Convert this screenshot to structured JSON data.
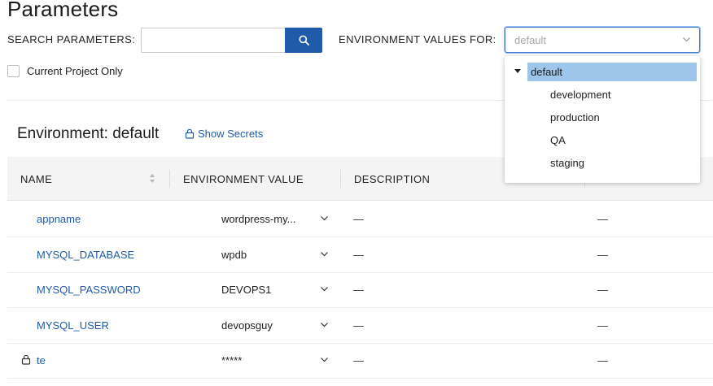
{
  "page": {
    "title": "Parameters"
  },
  "search": {
    "label": "SEARCH PARAMETERS",
    "colon": ":",
    "value": "",
    "placeholder": ""
  },
  "environment_select": {
    "label": "ENVIRONMENT VALUES FOR:",
    "placeholder": "default",
    "options": [
      {
        "label": "default",
        "selected": true
      },
      {
        "label": "development"
      },
      {
        "label": "production"
      },
      {
        "label": "QA"
      },
      {
        "label": "staging"
      }
    ]
  },
  "filters": {
    "current_project_only": "Current Project Only",
    "checked": false
  },
  "section": {
    "heading": "Environment: default",
    "show_secrets": "Show Secrets"
  },
  "table": {
    "columns": [
      "NAME",
      "ENVIRONMENT VALUE",
      "DESCRIPTION"
    ],
    "rows": [
      {
        "name": "appname",
        "value": "wordpress-my...",
        "description": "—",
        "extra": "—",
        "secret": false
      },
      {
        "name": "MYSQL_DATABASE",
        "value": "wpdb",
        "description": "—",
        "extra": "—",
        "secret": false
      },
      {
        "name": "MYSQL_PASSWORD",
        "value": "DEVOPS1",
        "description": "—",
        "extra": "—",
        "secret": false
      },
      {
        "name": "MYSQL_USER",
        "value": "devopsguy",
        "description": "—",
        "extra": "—",
        "secret": false
      },
      {
        "name": "te",
        "value": "*****",
        "description": "—",
        "extra": "—",
        "secret": true
      }
    ]
  },
  "colors": {
    "accent": "#1f5ba8",
    "selected_option": "#9ec6ea",
    "header_bg": "#f4f4f4"
  }
}
